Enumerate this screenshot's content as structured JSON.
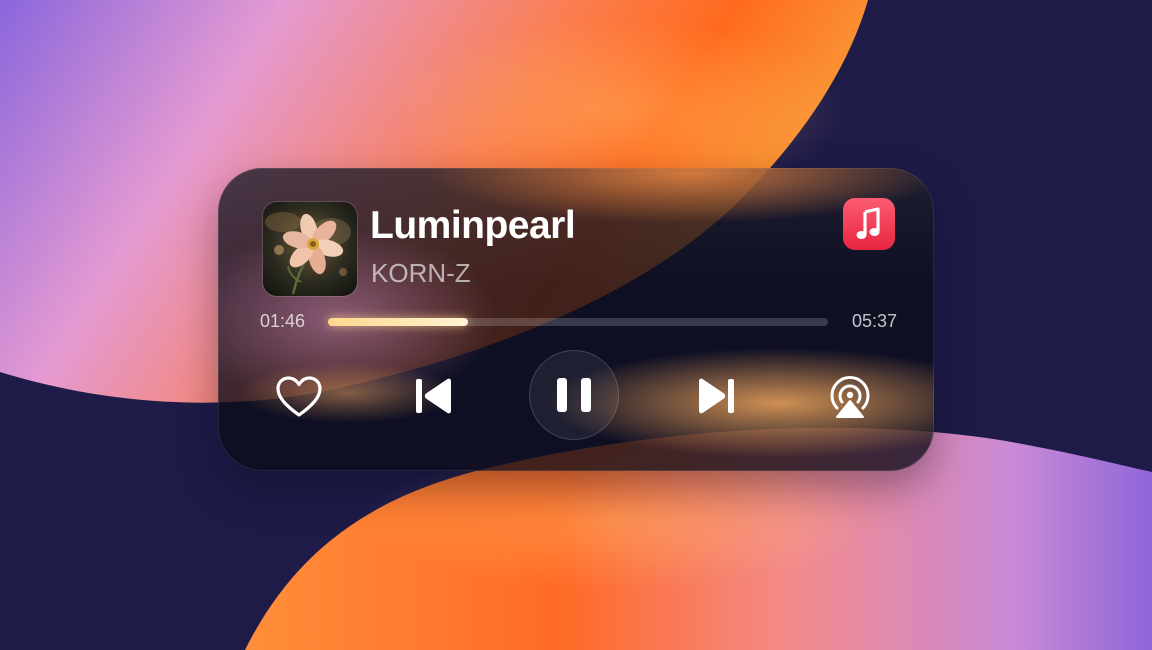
{
  "track": {
    "title": "Luminpearl",
    "artist": "KORN-Z"
  },
  "playback": {
    "elapsed": "01:46",
    "total": "05:37",
    "progress_fraction": 0.28,
    "state": "playing"
  },
  "app": {
    "icon": "music-note-icon",
    "accent_color": "#f0344d"
  },
  "controls": {
    "favorite_icon": "heart-outline-icon",
    "previous_icon": "skip-back-icon",
    "play_pause_icon": "pause-icon",
    "next_icon": "skip-forward-icon",
    "output_icon": "airplay-audio-icon"
  },
  "colors": {
    "progress": "#ffe3a8",
    "widget_background": "#0c0c18"
  }
}
